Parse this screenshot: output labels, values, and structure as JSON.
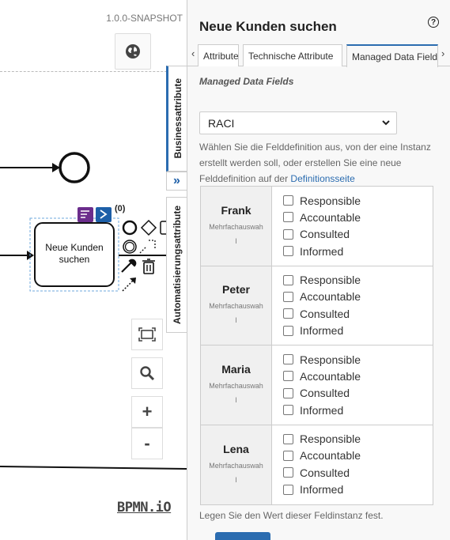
{
  "canvas": {
    "version": "1.0.0-SNAPSHOT",
    "task_label": "Neue Kunden suchen",
    "count_badge": "(0)",
    "zoom_in": "+",
    "zoom_out": "-",
    "logo": "BPMN.iO"
  },
  "vertical_tabs": {
    "business": "Businessattribute",
    "automation": "Automatisierungsattribute",
    "expand": "»"
  },
  "panel": {
    "title": "Neue Kunden suchen",
    "help": "?",
    "tabs": [
      "Attribute",
      "Technische Attribute",
      "Managed Data Fields"
    ],
    "tab_prev": "‹",
    "tab_next": "›",
    "section_title": "Managed Data Fields",
    "select_value": "RACI",
    "description": "Wählen Sie die Felddefinition aus, von der eine Instanz erstellt werden soll, oder erstellen Sie eine neue Felddefinition auf der ",
    "description_link": "Definitionsseite",
    "rows": [
      {
        "name": "Frank",
        "sub": "Mehrfachauswahl"
      },
      {
        "name": "Peter",
        "sub": "Mehrfachauswahl"
      },
      {
        "name": "Maria",
        "sub": "Mehrfachauswahl"
      },
      {
        "name": "Lena",
        "sub": "Mehrfachauswahl"
      }
    ],
    "options": [
      "Responsible",
      "Accountable",
      "Consulted",
      "Informed"
    ],
    "footer_note": "Legen Sie den Wert dieser Feldinstanz fest."
  },
  "colors": {
    "accent": "#2b6cb0",
    "badge_purple": "#6b2d8c",
    "badge_blue": "#1d5fa8",
    "selection": "#6fa8dc"
  }
}
